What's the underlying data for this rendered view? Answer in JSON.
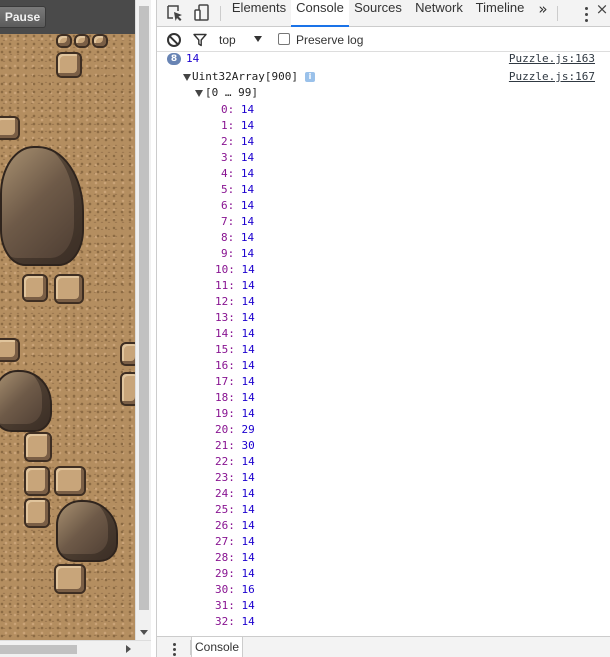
{
  "game": {
    "pause_label": "Pause"
  },
  "devtools": {
    "tabs": [
      {
        "label": "Elements"
      },
      {
        "label": "Console"
      },
      {
        "label": "Sources"
      },
      {
        "label": "Network"
      },
      {
        "label": "Timeline"
      }
    ],
    "more_tabs": "»",
    "close": "×",
    "filter": {
      "context": "top",
      "preserve_log_label": "Preserve log"
    },
    "console": {
      "messages": [
        {
          "repeat_count": "8",
          "value": "14",
          "source": "Puzzle.js:163"
        },
        {
          "label": "Uint32Array[900]",
          "info": "i",
          "source": "Puzzle.js:167",
          "range": "[0 … 99]"
        }
      ],
      "entries": [
        {
          "key": "0",
          "value": "14"
        },
        {
          "key": "1",
          "value": "14"
        },
        {
          "key": "2",
          "value": "14"
        },
        {
          "key": "3",
          "value": "14"
        },
        {
          "key": "4",
          "value": "14"
        },
        {
          "key": "5",
          "value": "14"
        },
        {
          "key": "6",
          "value": "14"
        },
        {
          "key": "7",
          "value": "14"
        },
        {
          "key": "8",
          "value": "14"
        },
        {
          "key": "9",
          "value": "14"
        },
        {
          "key": "10",
          "value": "14"
        },
        {
          "key": "11",
          "value": "14"
        },
        {
          "key": "12",
          "value": "14"
        },
        {
          "key": "13",
          "value": "14"
        },
        {
          "key": "14",
          "value": "14"
        },
        {
          "key": "15",
          "value": "14"
        },
        {
          "key": "16",
          "value": "14"
        },
        {
          "key": "17",
          "value": "14"
        },
        {
          "key": "18",
          "value": "14"
        },
        {
          "key": "19",
          "value": "14"
        },
        {
          "key": "20",
          "value": "29"
        },
        {
          "key": "21",
          "value": "30"
        },
        {
          "key": "22",
          "value": "14"
        },
        {
          "key": "23",
          "value": "14"
        },
        {
          "key": "24",
          "value": "14"
        },
        {
          "key": "25",
          "value": "14"
        },
        {
          "key": "26",
          "value": "14"
        },
        {
          "key": "27",
          "value": "14"
        },
        {
          "key": "28",
          "value": "14"
        },
        {
          "key": "29",
          "value": "14"
        },
        {
          "key": "30",
          "value": "16"
        },
        {
          "key": "31",
          "value": "14"
        },
        {
          "key": "32",
          "value": "14"
        }
      ]
    },
    "drawer": {
      "tab_label": "Console"
    }
  }
}
